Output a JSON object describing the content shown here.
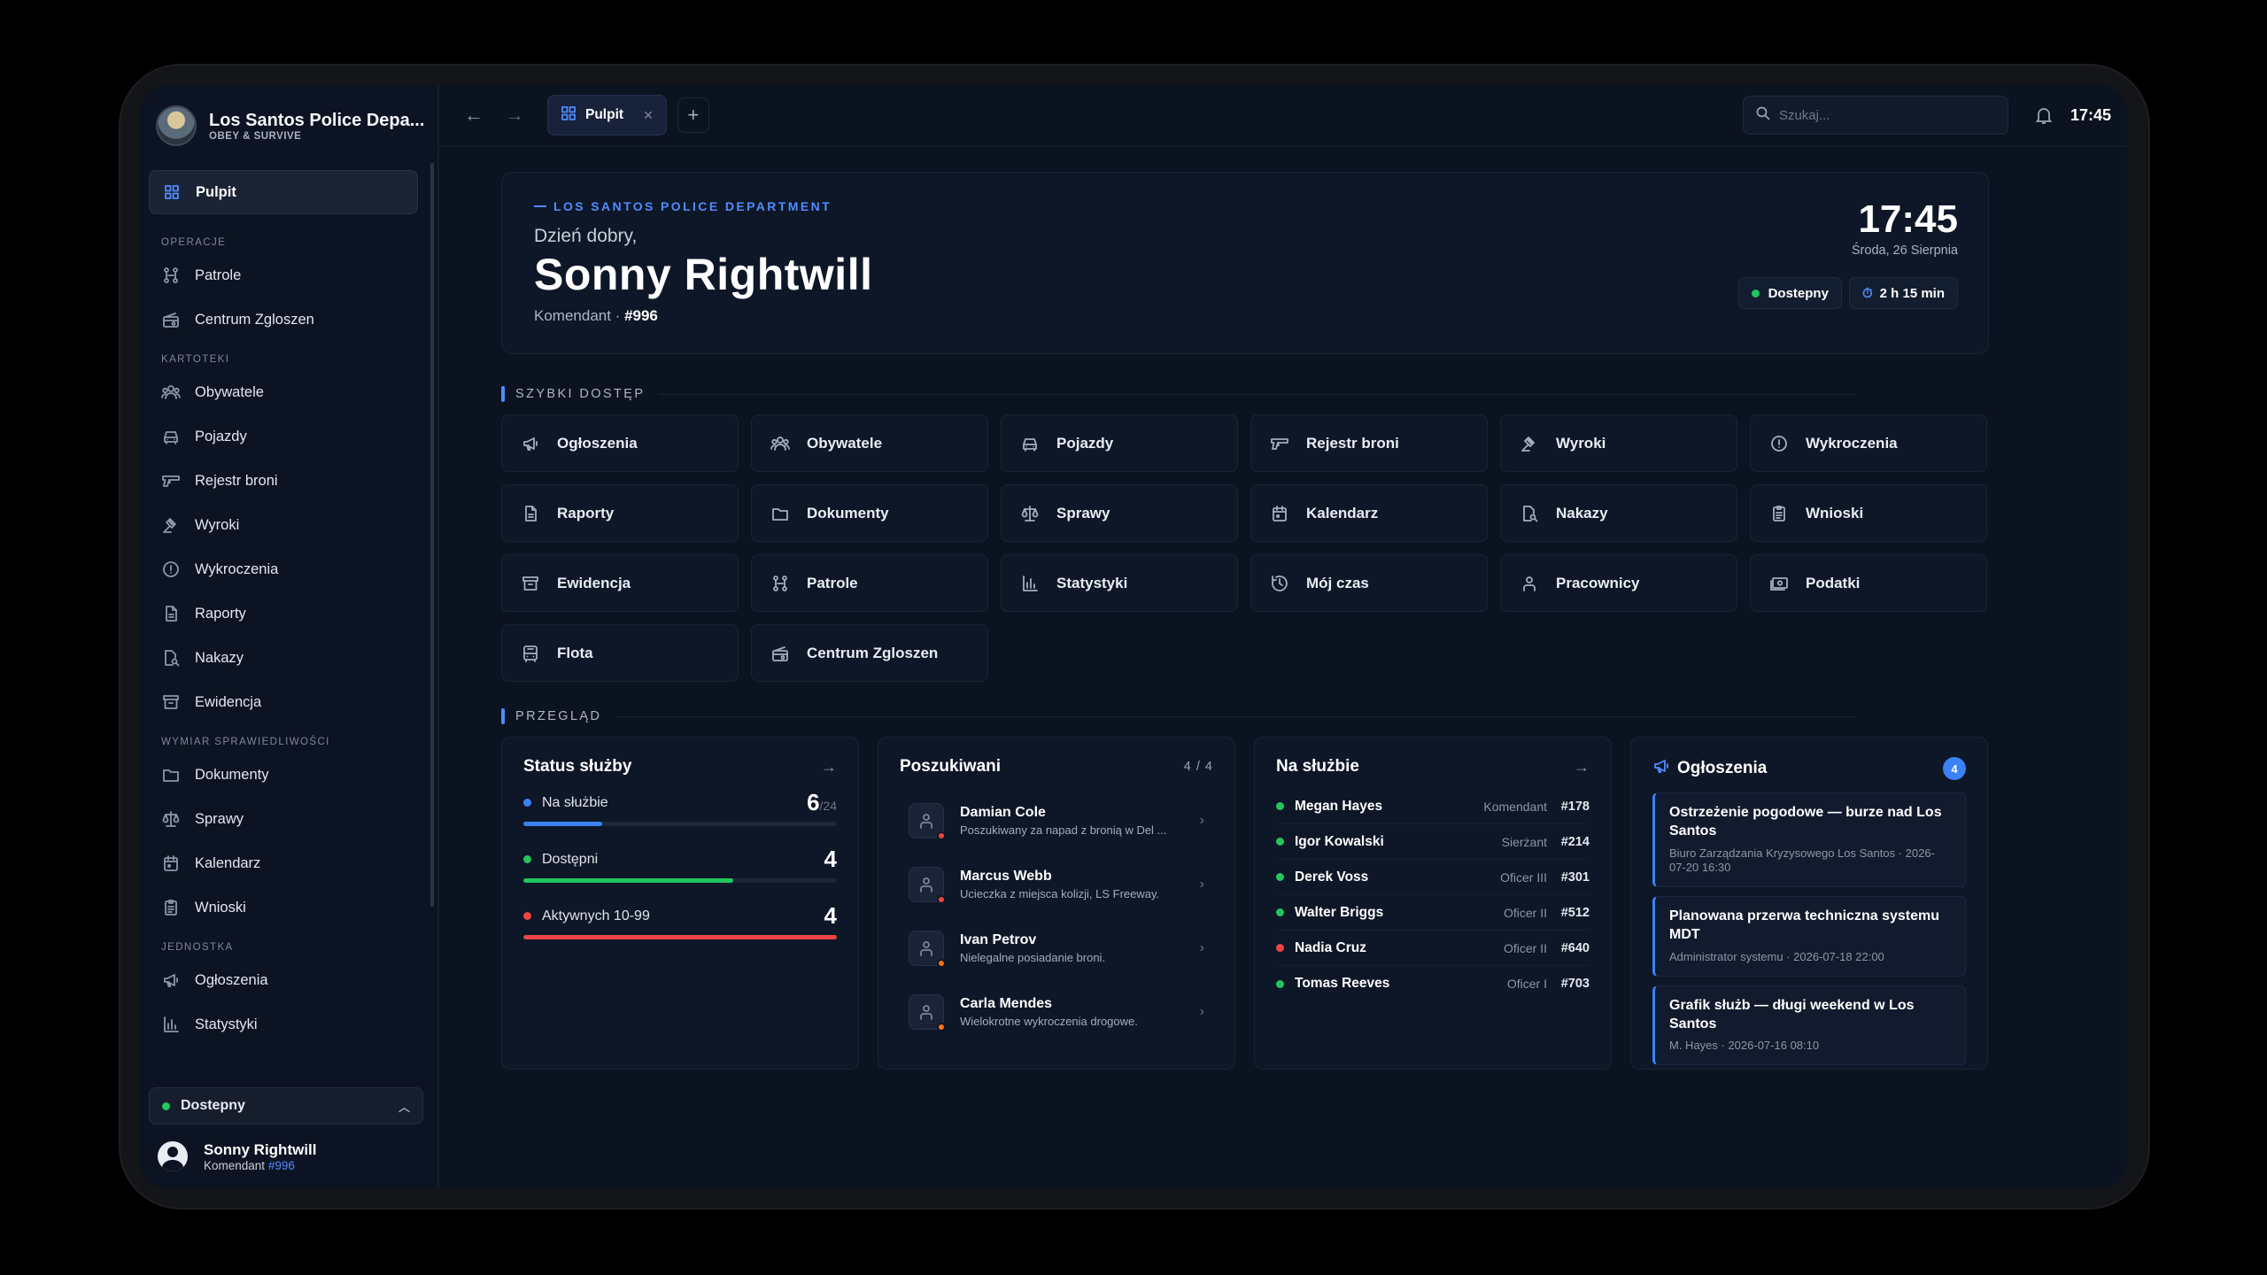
{
  "sidebar": {
    "brand_name": "Los Santos Police Depa...",
    "brand_sub": "OBEY & SURVIVE",
    "active": {
      "label": "Pulpit",
      "icon": "grid-icon"
    },
    "sections": [
      {
        "title": "OPERACJE",
        "items": [
          {
            "label": "Patrole",
            "icon": "route-icon"
          },
          {
            "label": "Centrum Zgloszen",
            "icon": "radio-icon"
          }
        ]
      },
      {
        "title": "KARTOTEKI",
        "items": [
          {
            "label": "Obywatele",
            "icon": "users-icon"
          },
          {
            "label": "Pojazdy",
            "icon": "car-icon"
          },
          {
            "label": "Rejestr broni",
            "icon": "gun-icon"
          },
          {
            "label": "Wyroki",
            "icon": "gavel-icon"
          },
          {
            "label": "Wykroczenia",
            "icon": "alert-circle-icon"
          },
          {
            "label": "Raporty",
            "icon": "file-icon"
          },
          {
            "label": "Nakazy",
            "icon": "file-search-icon"
          },
          {
            "label": "Ewidencja",
            "icon": "archive-icon"
          }
        ]
      },
      {
        "title": "WYMIAR SPRAWIEDLIWOŚCI",
        "items": [
          {
            "label": "Dokumenty",
            "icon": "folder-icon"
          },
          {
            "label": "Sprawy",
            "icon": "scale-icon"
          },
          {
            "label": "Kalendarz",
            "icon": "calendar-icon"
          },
          {
            "label": "Wnioski",
            "icon": "clipboard-icon"
          }
        ]
      },
      {
        "title": "JEDNOSTKA",
        "items": [
          {
            "label": "Ogłoszenia",
            "icon": "megaphone-icon"
          },
          {
            "label": "Statystyki",
            "icon": "chart-icon"
          }
        ]
      }
    ],
    "status": "Dostepny",
    "user_name": "Sonny Rightwill",
    "user_role": "Komendant",
    "user_number": "#996"
  },
  "topbar": {
    "tab_label": "Pulpit",
    "search_placeholder": "Szukaj...",
    "clock": "17:45"
  },
  "hero": {
    "kicker": "LOS SANTOS POLICE DEPARTMENT",
    "greeting": "Dzień dobry,",
    "name": "Sonny Rightwill",
    "role": "Komendant",
    "number": "#996",
    "time": "17:45",
    "date": "Środa, 26 Sierpnia",
    "status": "Dostepny",
    "duration": "2 h 15 min"
  },
  "quick_access": {
    "title": "SZYBKI DOSTĘP",
    "items": [
      {
        "label": "Ogłoszenia",
        "icon": "megaphone-icon"
      },
      {
        "label": "Obywatele",
        "icon": "users-icon"
      },
      {
        "label": "Pojazdy",
        "icon": "car-icon"
      },
      {
        "label": "Rejestr broni",
        "icon": "gun-icon"
      },
      {
        "label": "Wyroki",
        "icon": "gavel-icon"
      },
      {
        "label": "Wykroczenia",
        "icon": "alert-circle-icon"
      },
      {
        "label": "Raporty",
        "icon": "file-icon"
      },
      {
        "label": "Dokumenty",
        "icon": "folder-icon"
      },
      {
        "label": "Sprawy",
        "icon": "scale-icon"
      },
      {
        "label": "Kalendarz",
        "icon": "calendar-icon"
      },
      {
        "label": "Nakazy",
        "icon": "file-search-icon"
      },
      {
        "label": "Wnioski",
        "icon": "clipboard-icon"
      },
      {
        "label": "Ewidencja",
        "icon": "archive-icon"
      },
      {
        "label": "Patrole",
        "icon": "route-icon"
      },
      {
        "label": "Statystyki",
        "icon": "chart-icon"
      },
      {
        "label": "Mój czas",
        "icon": "clock-icon"
      },
      {
        "label": "Pracownicy",
        "icon": "person-icon"
      },
      {
        "label": "Podatki",
        "icon": "money-icon"
      },
      {
        "label": "Flota",
        "icon": "bus-icon"
      },
      {
        "label": "Centrum Zgloszen",
        "icon": "radio-icon"
      }
    ]
  },
  "overview": {
    "title": "PRZEGLĄD",
    "status": {
      "title": "Status służby",
      "rows": [
        {
          "label": "Na służbie",
          "value": "6",
          "total": "/24",
          "fraction": 0.25,
          "color": "#3b82f6"
        },
        {
          "label": "Dostępni",
          "value": "4",
          "total": "",
          "fraction": 0.67,
          "color": "#22c55e"
        },
        {
          "label": "Aktywnych 10-99",
          "value": "4",
          "total": "",
          "fraction": 1.0,
          "color": "#ef4444"
        }
      ]
    },
    "wanted": {
      "title": "Poszukiwani",
      "count": "4 / 4",
      "items": [
        {
          "name": "Damian Cole",
          "desc": "Poszukiwany za napad z bronią w Del ...",
          "dot": "red"
        },
        {
          "name": "Marcus Webb",
          "desc": "Ucieczka z miejsca kolizji, LS Freeway.",
          "dot": "red"
        },
        {
          "name": "Ivan Petrov",
          "desc": "Nielegalne posiadanie broni.",
          "dot": "orange"
        },
        {
          "name": "Carla Mendes",
          "desc": "Wielokrotne wykroczenia drogowe.",
          "dot": "orange"
        }
      ]
    },
    "on_duty": {
      "title": "Na służbie",
      "items": [
        {
          "name": "Megan Hayes",
          "rank": "Komendant",
          "num": "#178",
          "dot": "green"
        },
        {
          "name": "Igor Kowalski",
          "rank": "Sierżant",
          "num": "#214",
          "dot": "green"
        },
        {
          "name": "Derek Voss",
          "rank": "Oficer III",
          "num": "#301",
          "dot": "green"
        },
        {
          "name": "Walter Briggs",
          "rank": "Oficer II",
          "num": "#512",
          "dot": "green"
        },
        {
          "name": "Nadia Cruz",
          "rank": "Oficer II",
          "num": "#640",
          "dot": "red"
        },
        {
          "name": "Tomas Reeves",
          "rank": "Oficer I",
          "num": "#703",
          "dot": "green"
        }
      ]
    },
    "announcements": {
      "title": "Ogłoszenia",
      "badge": "4",
      "items": [
        {
          "title": "Ostrzeżenie pogodowe — burze nad Los Santos",
          "meta": "Biuro Zarządzania Kryzysowego Los Santos · 2026-07-20 16:30"
        },
        {
          "title": "Planowana przerwa techniczna systemu MDT",
          "meta": "Administrator systemu · 2026-07-18 22:00"
        },
        {
          "title": "Grafik służb — długi weekend w Los Santos",
          "meta": "M. Hayes · 2026-07-16 08:10"
        }
      ]
    }
  }
}
